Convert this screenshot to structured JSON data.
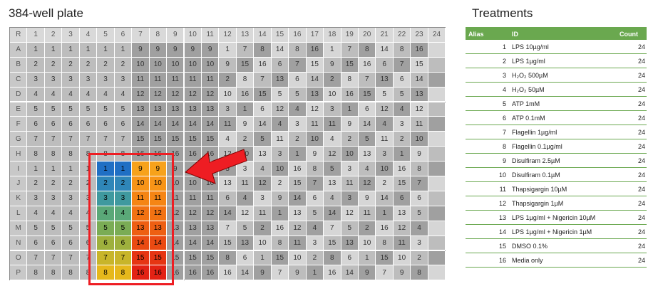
{
  "plate": {
    "title": "384-well plate",
    "corner_label": "R",
    "columns": [
      "1",
      "2",
      "3",
      "4",
      "5",
      "6",
      "7",
      "8",
      "9",
      "10",
      "11",
      "12",
      "13",
      "14",
      "15",
      "16",
      "17",
      "18",
      "19",
      "20",
      "21",
      "22",
      "23",
      "24"
    ],
    "rows": [
      "A",
      "B",
      "C",
      "D",
      "E",
      "F",
      "G",
      "H",
      "I",
      "J",
      "K",
      "L",
      "M",
      "N",
      "O",
      "P"
    ],
    "cells": [
      [
        "1",
        "1",
        "1",
        "1",
        "1",
        "1",
        "9",
        "9",
        "9",
        "9",
        "9",
        "1",
        "7",
        "8",
        "14",
        "8",
        "16",
        "1",
        "7",
        "8",
        "14",
        "8",
        "16"
      ],
      [
        "2",
        "2",
        "2",
        "2",
        "2",
        "2",
        "10",
        "10",
        "10",
        "10",
        "10",
        "9",
        "15",
        "16",
        "6",
        "7",
        "15",
        "9",
        "15",
        "16",
        "6",
        "7",
        "15"
      ],
      [
        "3",
        "3",
        "3",
        "3",
        "3",
        "3",
        "11",
        "11",
        "11",
        "11",
        "11",
        "2",
        "8",
        "7",
        "13",
        "6",
        "14",
        "2",
        "8",
        "7",
        "13",
        "6",
        "14"
      ],
      [
        "4",
        "4",
        "4",
        "4",
        "4",
        "4",
        "12",
        "12",
        "12",
        "12",
        "12",
        "10",
        "16",
        "15",
        "5",
        "5",
        "13",
        "10",
        "16",
        "15",
        "5",
        "5",
        "13"
      ],
      [
        "5",
        "5",
        "5",
        "5",
        "5",
        "5",
        "13",
        "13",
        "13",
        "13",
        "13",
        "3",
        "1",
        "6",
        "12",
        "4",
        "12",
        "3",
        "1",
        "6",
        "12",
        "4",
        "12"
      ],
      [
        "6",
        "6",
        "6",
        "6",
        "6",
        "6",
        "14",
        "14",
        "14",
        "14",
        "14",
        "11",
        "9",
        "14",
        "4",
        "3",
        "11",
        "11",
        "9",
        "14",
        "4",
        "3",
        "11"
      ],
      [
        "7",
        "7",
        "7",
        "7",
        "7",
        "7",
        "15",
        "15",
        "15",
        "15",
        "15",
        "4",
        "2",
        "5",
        "11",
        "2",
        "10",
        "4",
        "2",
        "5",
        "11",
        "2",
        "10"
      ],
      [
        "8",
        "8",
        "8",
        "8",
        "8",
        "8",
        "16",
        "16",
        "16",
        "16",
        "16",
        "12",
        "10",
        "13",
        "3",
        "1",
        "9",
        "12",
        "10",
        "13",
        "3",
        "1",
        "9"
      ],
      [
        "1",
        "1",
        "1",
        "1",
        "1",
        "1",
        "9",
        "9",
        "9",
        "9",
        "9",
        "5",
        "3",
        "4",
        "10",
        "16",
        "8",
        "5",
        "3",
        "4",
        "10",
        "16",
        "8"
      ],
      [
        "2",
        "2",
        "2",
        "2",
        "2",
        "2",
        "10",
        "10",
        "10",
        "10",
        "10",
        "13",
        "11",
        "12",
        "2",
        "15",
        "7",
        "13",
        "11",
        "12",
        "2",
        "15",
        "7"
      ],
      [
        "3",
        "3",
        "3",
        "3",
        "3",
        "3",
        "11",
        "11",
        "11",
        "11",
        "11",
        "6",
        "4",
        "3",
        "9",
        "14",
        "6",
        "4",
        "3",
        "9",
        "14",
        "6",
        "6"
      ],
      [
        "4",
        "4",
        "4",
        "4",
        "4",
        "4",
        "12",
        "12",
        "12",
        "12",
        "12",
        "14",
        "12",
        "11",
        "1",
        "13",
        "5",
        "14",
        "12",
        "11",
        "1",
        "13",
        "5"
      ],
      [
        "5",
        "5",
        "5",
        "5",
        "5",
        "5",
        "13",
        "13",
        "13",
        "13",
        "13",
        "7",
        "5",
        "2",
        "16",
        "12",
        "4",
        "7",
        "5",
        "2",
        "16",
        "12",
        "4"
      ],
      [
        "6",
        "6",
        "6",
        "6",
        "6",
        "6",
        "14",
        "14",
        "14",
        "14",
        "14",
        "15",
        "13",
        "10",
        "8",
        "11",
        "3",
        "15",
        "13",
        "10",
        "8",
        "11",
        "3"
      ],
      [
        "7",
        "7",
        "7",
        "7",
        "7",
        "7",
        "15",
        "15",
        "15",
        "15",
        "15",
        "8",
        "6",
        "1",
        "15",
        "10",
        "2",
        "8",
        "6",
        "1",
        "15",
        "10",
        "2"
      ],
      [
        "8",
        "8",
        "8",
        "8",
        "8",
        "8",
        "16",
        "16",
        "16",
        "16",
        "16",
        "16",
        "14",
        "9",
        "7",
        "9",
        "1",
        "16",
        "14",
        "9",
        "7",
        "9",
        "8"
      ]
    ],
    "highlight_colors": {
      "1": "#1f6fc4",
      "2": "#2f86b8",
      "3": "#3f999f",
      "4": "#5aa878",
      "5": "#7aac55",
      "6": "#9eb03d",
      "7": "#c8b52a",
      "8": "#e6b81c",
      "9": "#f7a21b",
      "10": "#f79417",
      "11": "#f58514",
      "12": "#f27212",
      "13": "#ee5f12",
      "14": "#ea4a12",
      "15": "#e63513",
      "16": "#e32214"
    },
    "highlight_border": "#ee1d23",
    "arrow_color": "#ee1d23"
  },
  "treatments": {
    "title": "Treatments",
    "header": {
      "alias": "Alias",
      "id": "ID",
      "count": "Count"
    },
    "header_color": "#6aa84f",
    "rows": [
      {
        "alias": "1",
        "id": "LPS 10µg/ml",
        "count": "24"
      },
      {
        "alias": "2",
        "id": "LPS 1µg/ml",
        "count": "24"
      },
      {
        "alias": "3",
        "id": "H₂O₂ 500µM",
        "count": "24"
      },
      {
        "alias": "4",
        "id": "H₂O₂ 50µM",
        "count": "24"
      },
      {
        "alias": "5",
        "id": "ATP 1mM",
        "count": "24"
      },
      {
        "alias": "6",
        "id": "ATP 0.1mM",
        "count": "24"
      },
      {
        "alias": "7",
        "id": "Flagellin 1µg/ml",
        "count": "24"
      },
      {
        "alias": "8",
        "id": "Flagellin 0.1µg/ml",
        "count": "24"
      },
      {
        "alias": "9",
        "id": "Disulfiram 2.5µM",
        "count": "24"
      },
      {
        "alias": "10",
        "id": "Disulfiram 0.1µM",
        "count": "24"
      },
      {
        "alias": "11",
        "id": "Thapsigargin 10µM",
        "count": "24"
      },
      {
        "alias": "12",
        "id": "Thapsigargin 1µM",
        "count": "24"
      },
      {
        "alias": "13",
        "id": "LPS 1µg/ml + Nigericin 10µM",
        "count": "24"
      },
      {
        "alias": "14",
        "id": "LPS 1µg/ml + Nigericin 1µM",
        "count": "24"
      },
      {
        "alias": "15",
        "id": "DMSO 0.1%",
        "count": "24"
      },
      {
        "alias": "16",
        "id": "Media only",
        "count": "24"
      }
    ]
  }
}
